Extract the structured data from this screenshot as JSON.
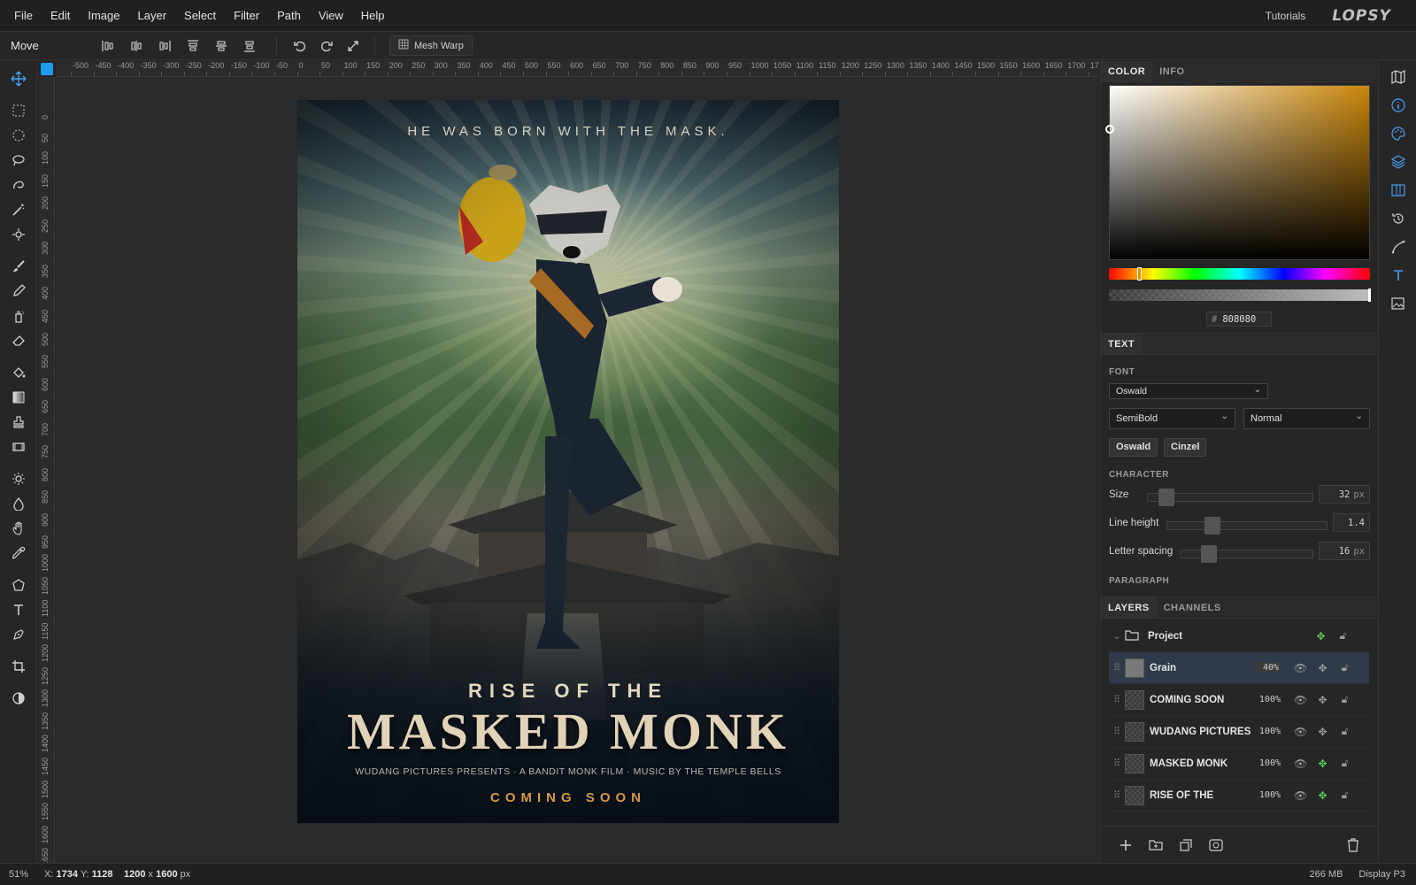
{
  "menubar": {
    "items": [
      "File",
      "Edit",
      "Image",
      "Layer",
      "Select",
      "Filter",
      "Path",
      "View",
      "Help"
    ],
    "tutorials": "Tutorials",
    "logo": "LOPSY"
  },
  "options": {
    "tool_name": "Move",
    "mesh_warp": "Mesh Warp"
  },
  "ruler": {
    "h_labels": [
      "-500",
      "-450",
      "-400",
      "-350",
      "-300",
      "-250",
      "-200",
      "-150",
      "-100",
      "-50",
      "0",
      "50",
      "100",
      "150",
      "200",
      "250",
      "300",
      "350",
      "400",
      "450",
      "500",
      "550",
      "600",
      "650",
      "700",
      "750",
      "800",
      "850",
      "900",
      "950",
      "1000",
      "1050",
      "1100",
      "1150",
      "1200",
      "1250",
      "1300",
      "1350",
      "1400",
      "1450",
      "1500",
      "1550",
      "1600",
      "1650",
      "1700",
      "17"
    ],
    "v_labels": [
      "0",
      "50",
      "100",
      "150",
      "200",
      "250",
      "300",
      "350",
      "400",
      "450",
      "500",
      "550",
      "600",
      "650",
      "700",
      "750",
      "800",
      "850",
      "900",
      "950",
      "1000",
      "1050",
      "1100",
      "1150",
      "1200",
      "1250",
      "1300",
      "1350",
      "1400",
      "1450",
      "1500",
      "1550",
      "1600",
      "1650"
    ]
  },
  "poster": {
    "tagline": "HE WAS BORN WITH THE MASK.",
    "rise": "RISE OF THE",
    "masked": "MASKED MONK",
    "credits": "WUDANG PICTURES PRESENTS · A BANDIT MONK FILM · MUSIC BY THE TEMPLE BELLS",
    "coming": "COMING SOON"
  },
  "color_panel": {
    "tabs": [
      "COLOR",
      "INFO"
    ],
    "hex_prefix": "#",
    "hex": "808080"
  },
  "text_panel": {
    "tab": "TEXT",
    "font_label": "FONT",
    "font_family": "Oswald",
    "weight": "SemiBold",
    "style": "Normal",
    "recent_fonts": [
      "Oswald",
      "Cinzel"
    ],
    "character_label": "CHARACTER",
    "size_label": "Size",
    "size_value": "32",
    "size_unit": "px",
    "line_height_label": "Line height",
    "line_height_value": "1.4",
    "letter_spacing_label": "Letter spacing",
    "letter_spacing_value": "16",
    "letter_spacing_unit": "px",
    "paragraph_label": "PARAGRAPH"
  },
  "layers_panel": {
    "tabs": [
      "LAYERS",
      "CHANNELS"
    ],
    "group_name": "Project",
    "layers": [
      {
        "name": "Grain",
        "opacity": "40%"
      },
      {
        "name": "COMING SOON",
        "opacity": "100%"
      },
      {
        "name": "WUDANG PICTURES",
        "opacity": "100%"
      },
      {
        "name": "MASKED MONK",
        "opacity": "100%"
      },
      {
        "name": "RISE OF THE",
        "opacity": "100%"
      }
    ]
  },
  "status": {
    "zoom": "51%",
    "x_label": "X:",
    "x": "1734",
    "y_label": "Y:",
    "y": "1128",
    "width": "1200",
    "times": "x",
    "height": "1600",
    "unit": "px",
    "memory": "266 MB",
    "profile": "Display P3"
  },
  "colors": {
    "accent": "#4a9cf0",
    "selected_layer": "#2f3a48",
    "coming_soon": "#d59a44"
  }
}
